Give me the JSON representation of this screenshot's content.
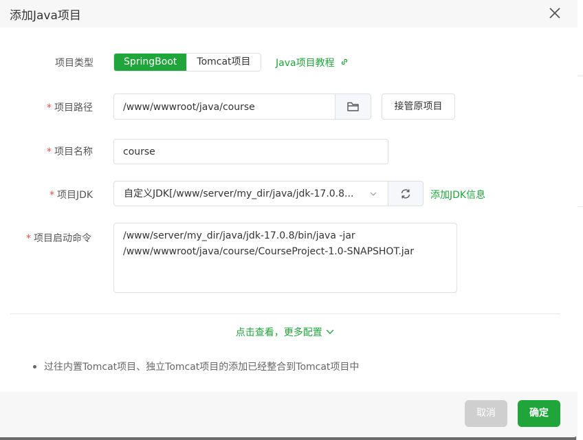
{
  "dialog": {
    "title": "添加Java项目",
    "close_icon": "close-icon"
  },
  "form": {
    "project_type": {
      "label": "项目类型",
      "options": [
        "SpringBoot",
        "Tomcat项目"
      ],
      "selected": "SpringBoot",
      "tutorial_link": "Java项目教程",
      "link_icon": "link-icon"
    },
    "project_path": {
      "label": "项目路径",
      "value": "/www/wwwroot/java/course",
      "folder_icon": "folder-icon",
      "takeover_button": "接管原项目"
    },
    "project_name": {
      "label": "项目名称",
      "value": "course"
    },
    "project_jdk": {
      "label": "项目JDK",
      "value": "自定义JDK[/www/server/my_dir/java/jdk-17.0.8...",
      "refresh_icon": "refresh-icon",
      "add_jdk_link": "添加JDK信息"
    },
    "start_command": {
      "label": "项目启动命令",
      "lines": [
        "/www/server/my_dir/java/jdk-17.0.8/bin/java -jar",
        "/www/wwwroot/java/course/CourseProject-1.0-SNAPSHOT.jar"
      ]
    }
  },
  "more_config": "点击查看，更多配置",
  "notes": [
    "过往内置Tomcat项目、独立Tomcat项目的添加已经整合到Tomcat项目中"
  ],
  "footer": {
    "cancel": "取消",
    "confirm": "确定"
  },
  "colors": {
    "accent": "#20a53a",
    "required": "#f44747"
  }
}
